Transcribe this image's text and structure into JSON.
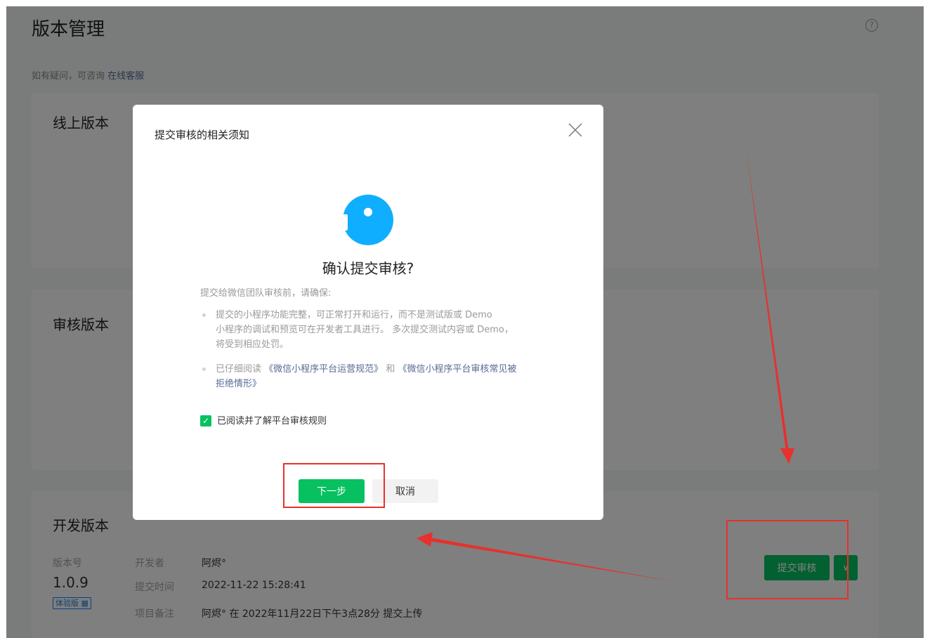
{
  "header": {
    "title": "版本管理",
    "help_icon": "?",
    "consult_prefix": "如有疑问，可咨询",
    "consult_link": "在线客服"
  },
  "cards": {
    "online": {
      "title": "线上版本"
    },
    "review": {
      "title": "审核版本"
    },
    "dev": {
      "title": "开发版本",
      "version_label": "版本号",
      "version": "1.0.9",
      "badge": "体验版",
      "developer_label": "开发者",
      "developer": "阿烬°",
      "submit_time_label": "提交时间",
      "submit_time": "2022-11-22 15:28:41",
      "note_label": "项目备注",
      "note": "阿烬° 在 2022年11月22日下午3点28分 提交上传",
      "submit_button": "提交审核",
      "dropdown_icon": "chevron-down-icon"
    }
  },
  "dialog": {
    "title": "提交审核的相关须知",
    "confirm_title": "确认提交审核?",
    "intro": "提交给微信团队审核前，请确保:",
    "bullet1_lines": [
      "提交的小程序功能完整，可正常打开和运行，而不是测试版或 Demo",
      "小程序的调试和预览可在开发者工具进行。 多次提交测试内容或 Demo，",
      "将受到相应处罚。"
    ],
    "bullet2_prefix": "已仔细阅读",
    "bullet2_link1": "《微信小程序平台运营规范》",
    "bullet2_and": "和",
    "bullet2_link2_line1": "《微信小程序平台审核常见被",
    "bullet2_link2_line2": "拒绝情形》",
    "checkbox_label": "已阅读并了解平台审核规则",
    "checkbox_checked": true,
    "next_button": "下一步",
    "cancel_button": "取消"
  },
  "colors": {
    "accent_green": "#07c160",
    "info_blue": "#10aeff",
    "link_blue": "#576b95",
    "annotation_red": "#e8302d"
  }
}
